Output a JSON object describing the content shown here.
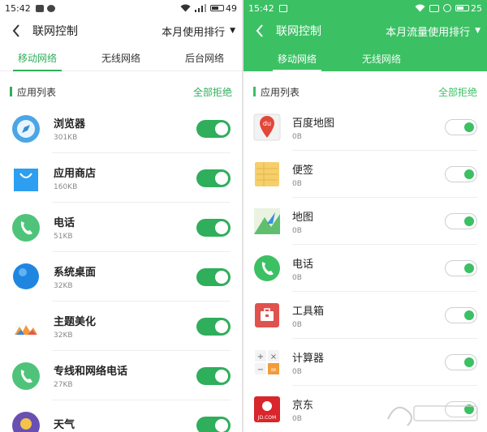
{
  "left": {
    "status": {
      "time": "15:42",
      "battery": "49"
    },
    "title": "联网控制",
    "sort_label": "本月使用排行",
    "tabs": [
      "移动网络",
      "无线网络",
      "后台网络"
    ],
    "active_tab": 0,
    "section_label": "应用列表",
    "reject_all": "全部拒绝",
    "apps": [
      {
        "name": "浏览器",
        "size": "301KB",
        "icon": "browser-icon",
        "enabled": true
      },
      {
        "name": "应用商店",
        "size": "160KB",
        "icon": "app-store-icon",
        "enabled": true
      },
      {
        "name": "电话",
        "size": "51KB",
        "icon": "phone-icon",
        "enabled": true
      },
      {
        "name": "系统桌面",
        "size": "32KB",
        "icon": "desktop-icon",
        "enabled": true
      },
      {
        "name": "主题美化",
        "size": "32KB",
        "icon": "theme-icon",
        "enabled": true
      },
      {
        "name": "专线和网络电话",
        "size": "27KB",
        "icon": "phone-icon",
        "enabled": true
      },
      {
        "name": "天气",
        "size": "",
        "icon": "weather-icon",
        "enabled": true
      }
    ]
  },
  "right": {
    "status": {
      "time": "15:42",
      "battery": "25"
    },
    "title": "联网控制",
    "sort_label": "本月流量使用排行",
    "tabs": [
      "移动网络",
      "无线网络"
    ],
    "active_tab": 0,
    "section_label": "应用列表",
    "reject_all": "全部拒绝",
    "apps": [
      {
        "name": "百度地图",
        "size": "0B",
        "icon": "baidu-map-icon",
        "enabled": true
      },
      {
        "name": "便签",
        "size": "0B",
        "icon": "notes-icon",
        "enabled": true
      },
      {
        "name": "地图",
        "size": "0B",
        "icon": "map-icon",
        "enabled": true
      },
      {
        "name": "电话",
        "size": "0B",
        "icon": "phone-icon",
        "enabled": true
      },
      {
        "name": "工具箱",
        "size": "0B",
        "icon": "toolbox-icon",
        "enabled": true
      },
      {
        "name": "计算器",
        "size": "0B",
        "icon": "calculator-icon",
        "enabled": true
      },
      {
        "name": "京东",
        "size": "0B",
        "icon": "jd-icon",
        "enabled": true
      }
    ]
  },
  "icon_text": {
    "baidu_map": "du",
    "jd": "JD.COM"
  },
  "colors": {
    "accent_left": "#2fae5b",
    "header_right": "#3cc064",
    "toggle_on_left": "#2fae5b",
    "toggle_knob_right": "#3cc064"
  }
}
